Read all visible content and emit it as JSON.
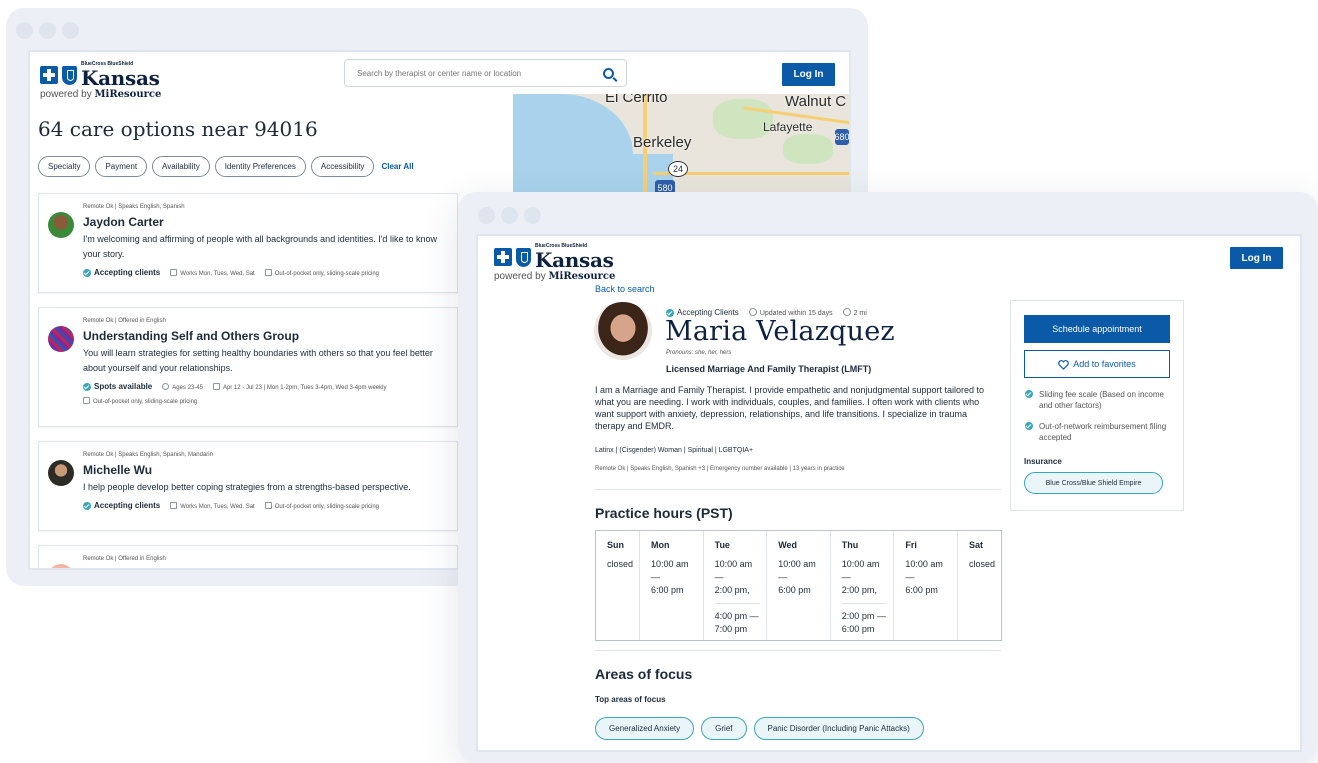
{
  "back_window": {
    "brand": {
      "small": "BlueCross BlueShield",
      "name": "Kansas",
      "powered_prefix": "powered by ",
      "powered_brand": "MiResource"
    },
    "search": {
      "placeholder": "Search by therapist or center name or location"
    },
    "login_label": "Log In",
    "map": {
      "labels": [
        "El Cerrito",
        "Walnut C",
        "Lafayette",
        "Berkeley"
      ],
      "signs": [
        "24",
        "580",
        "680"
      ]
    },
    "results_title": "64 care options near 94016",
    "filters": [
      "Specialty",
      "Payment",
      "Availability",
      "Identity Preferences",
      "Accessibility"
    ],
    "clear_all": "Clear All",
    "cards": [
      {
        "meta": "Remote Ok  |  Speaks English, Spanish",
        "name": "Jaydon Carter",
        "desc": "I'm welcoming and affirming of people with all backgrounds and identities. I'd like to know your story.",
        "status": "Accepting clients",
        "tag1": "Works Mon, Tues, Wed, Sat",
        "tag2": "Out-of-pocket only, sliding-scale pricing"
      },
      {
        "meta": "Remote Ok  |  Offered in English",
        "name": "Understanding Self and Others Group",
        "desc": "You will learn strategies for setting healthy boundaries with others so that you feel better about yourself and your relationships.",
        "status": "Spots available",
        "tag1": "Ages 23-45",
        "tag2": "Apr 12 - Jul 23  |  Mon 1-2pm, Tues 3-4pm, Wed 3-4pm weekly",
        "tag3": "Out-of-pocket only, sliding-scale pricing"
      },
      {
        "meta": "Remote Ok  |  Speaks English, Spanish, Mandarin",
        "name": "Michelle Wu",
        "desc": "I help people develop better coping strategies from a strengths-based perspective.",
        "status": "Accepting clients",
        "tag1": "Works Mon, Tues, Wed, Sat",
        "tag2": "Out-of-pocket only, sliding-scale pricing"
      },
      {
        "meta": "Remote Ok  |  Offered in English"
      }
    ]
  },
  "front_window": {
    "brand": {
      "small": "BlueCross BlueShield",
      "name": "Kansas",
      "powered_prefix": "powered by ",
      "powered_brand": "MiResource"
    },
    "login_label": "Log In",
    "back_link": "Back to search",
    "status": {
      "accepting": "Accepting Clients",
      "updated": "Updated within 15 days",
      "distance": "2 mi"
    },
    "name": "Maria Velazquez",
    "pronouns": "Pronouns: she, her, hers",
    "credential": "Licensed Marriage And Family Therapist (LMFT)",
    "bio": "I am a Marriage and Family Therapist. I provide empathetic and nonjudgmental support tailored to what you are needing. I work with individuals, couples, and families. I often work with clients who want support with anxiety, depression, relationships, and life transitions. I specialize in trauma therapy and EMDR.",
    "identities": "Latinx  |  (Cisgender) Woman  |  Spiritual  |  LGBTQIA+",
    "meta": "Remote Ok  |  Speaks English, Spanish +3  |  Emergency number available  |  13 years in practice",
    "hours_title": "Practice hours (PST)",
    "hours": {
      "days": [
        "Sun",
        "Mon",
        "Tue",
        "Wed",
        "Thu",
        "Fri",
        "Sat"
      ],
      "slots": [
        [
          "closed"
        ],
        [
          "10:00 am —\n6:00 pm"
        ],
        [
          "10:00 am —\n2:00 pm,",
          "4:00 pm —\n7:00 pm"
        ],
        [
          "10:00 am —\n6:00 pm"
        ],
        [
          "10:00 am —\n2:00 pm,",
          "2:00 pm —\n6:00 pm"
        ],
        [
          "10:00 am —\n6:00 pm"
        ],
        [
          "closed"
        ]
      ]
    },
    "focus_title": "Areas of focus",
    "focus_sub": "Top areas of focus",
    "focus_items": [
      "Generalized Anxiety",
      "Grief",
      "Panic Disorder (Including Panic Attacks)"
    ],
    "sidebar": {
      "schedule": "Schedule appointment",
      "favorite": "Add to favorites",
      "features": [
        "Sliding fee scale (Based on income and other factors)",
        "Out-of-network reimbursement filing accepted"
      ],
      "insurance_title": "Insurance",
      "insurance": "Blue Cross/Blue Shield Empire"
    }
  },
  "colors": {
    "brand": "#0a5aa8",
    "accent": "#3aa6bb",
    "navy": "#0d2140"
  }
}
